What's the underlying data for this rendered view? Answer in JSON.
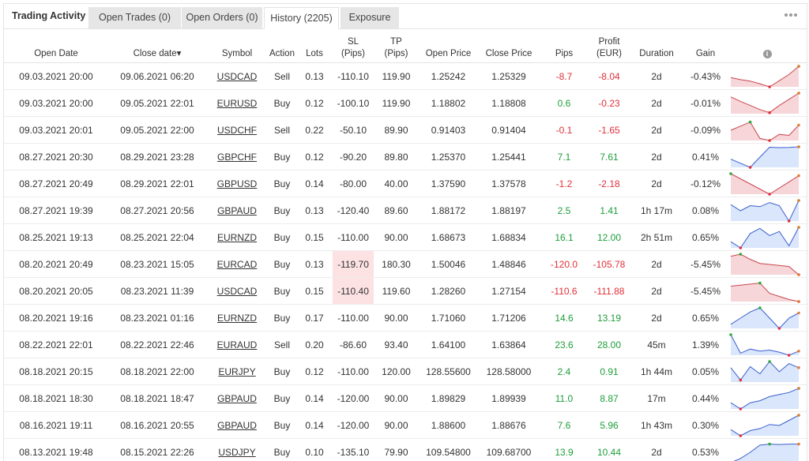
{
  "title": "Trading Activity",
  "tabs": [
    {
      "label": "Open Trades (0)"
    },
    {
      "label": "Open Orders (0)"
    },
    {
      "label": "History (2205)"
    },
    {
      "label": "Exposure"
    }
  ],
  "active_tab": "History (2205)",
  "columns": {
    "open_date": "Open Date",
    "close_date": "Close date",
    "sort_arrow": "▾",
    "symbol": "Symbol",
    "action": "Action",
    "lots": "Lots",
    "sl_1": "SL",
    "sl_2": "(Pips)",
    "tp_1": "TP",
    "tp_2": "(Pips)",
    "open_price": "Open Price",
    "close_price": "Close Price",
    "pips": "Pips",
    "profit_1": "Profit",
    "profit_2": "(EUR)",
    "duration": "Duration",
    "gain": "Gain",
    "info_glyph": "i"
  },
  "colors": {
    "positive": "#1e9e3a",
    "negative": "#e0303a",
    "spark_profit_fill": "#d9e6fb",
    "spark_profit_line": "#3a5fcd",
    "spark_loss_fill": "#f6d6d8",
    "spark_loss_line": "#c8474f"
  },
  "rows": [
    {
      "open_date": "09.03.2021 20:00",
      "close_date": "09.06.2021 06:20",
      "symbol": "USDCAD",
      "action": "Sell",
      "lots": "0.13",
      "sl": "-110.10",
      "tp": "119.90",
      "open_price": "1.25242",
      "close_price": "1.25329",
      "pips": "-8.7",
      "profit": "-8.04",
      "duration": "2d",
      "gain": "-0.43%",
      "spark": [
        0.45,
        0.35,
        0.28,
        0.15,
        0.0,
        0.3,
        0.6,
        1.0
      ]
    },
    {
      "open_date": "09.03.2021 20:00",
      "close_date": "09.05.2021 22:01",
      "symbol": "EURUSD",
      "action": "Buy",
      "lots": "0.12",
      "sl": "-100.10",
      "tp": "119.90",
      "open_price": "1.18802",
      "close_price": "1.18808",
      "pips": "0.6",
      "profit": "-0.23",
      "duration": "2d",
      "gain": "-0.01%",
      "spark": [
        0.82,
        0.6,
        0.4,
        0.2,
        0.05,
        0.4,
        0.7,
        1.0
      ]
    },
    {
      "open_date": "09.03.2021 20:01",
      "close_date": "09.05.2021 22:00",
      "symbol": "USDCHF",
      "action": "Sell",
      "lots": "0.22",
      "sl": "-50.10",
      "tp": "89.90",
      "open_price": "0.91403",
      "close_price": "0.91404",
      "pips": "-0.1",
      "profit": "-1.65",
      "duration": "2d",
      "gain": "-0.09%",
      "spark": [
        0.5,
        0.7,
        0.9,
        0.1,
        0.0,
        0.3,
        0.25,
        0.75
      ]
    },
    {
      "open_date": "08.27.2021 20:30",
      "close_date": "08.29.2021 23:28",
      "symbol": "GBPCHF",
      "action": "Buy",
      "lots": "0.12",
      "sl": "-90.20",
      "tp": "89.80",
      "open_price": "1.25370",
      "close_price": "1.25441",
      "pips": "7.1",
      "profit": "7.61",
      "duration": "2d",
      "gain": "0.41%",
      "spark": [
        0.4,
        0.2,
        0.0,
        0.5,
        0.98,
        0.96,
        0.97,
        1.0
      ]
    },
    {
      "open_date": "08.27.2021 20:49",
      "close_date": "08.29.2021 22:01",
      "symbol": "GBPUSD",
      "action": "Buy",
      "lots": "0.14",
      "sl": "-80.00",
      "tp": "40.00",
      "open_price": "1.37590",
      "close_price": "1.37578",
      "pips": "-1.2",
      "profit": "-2.18",
      "duration": "2d",
      "gain": "-0.12%",
      "spark": [
        1.0,
        0.75,
        0.5,
        0.25,
        0.0,
        0.3,
        0.6,
        0.9
      ]
    },
    {
      "open_date": "08.27.2021 19:39",
      "close_date": "08.27.2021 20:56",
      "symbol": "GBPAUD",
      "action": "Buy",
      "lots": "0.13",
      "sl": "-120.40",
      "tp": "89.60",
      "open_price": "1.88172",
      "close_price": "1.88197",
      "pips": "2.5",
      "profit": "1.41",
      "duration": "1h 17m",
      "gain": "0.08%",
      "spark": [
        0.8,
        0.5,
        0.75,
        0.7,
        0.9,
        0.75,
        0.0,
        1.0
      ]
    },
    {
      "open_date": "08.25.2021 19:13",
      "close_date": "08.25.2021 22:04",
      "symbol": "EURNZD",
      "action": "Buy",
      "lots": "0.15",
      "sl": "-110.00",
      "tp": "90.00",
      "open_price": "1.68673",
      "close_price": "1.68834",
      "pips": "16.1",
      "profit": "12.00",
      "duration": "2h 51m",
      "gain": "0.65%",
      "spark": [
        0.3,
        0.0,
        0.7,
        0.95,
        0.6,
        0.8,
        0.1,
        1.0
      ]
    },
    {
      "open_date": "08.20.2021 20:49",
      "close_date": "08.23.2021 15:05",
      "symbol": "EURCAD",
      "action": "Buy",
      "lots": "0.13",
      "sl": "-119.70",
      "tp": "180.30",
      "open_price": "1.50046",
      "close_price": "1.48846",
      "pips": "-120.0",
      "profit": "-105.78",
      "duration": "2d",
      "gain": "-5.45%",
      "spark": [
        0.9,
        1.0,
        0.75,
        0.55,
        0.5,
        0.45,
        0.4,
        0.0
      ]
    },
    {
      "open_date": "08.20.2021 20:05",
      "close_date": "08.23.2021 11:39",
      "symbol": "USDCAD",
      "action": "Buy",
      "lots": "0.15",
      "sl": "-110.40",
      "tp": "119.60",
      "open_price": "1.28260",
      "close_price": "1.27154",
      "pips": "-110.6",
      "profit": "-111.88",
      "duration": "2d",
      "gain": "-5.45%",
      "spark": [
        0.75,
        0.8,
        0.85,
        0.9,
        0.4,
        0.25,
        0.1,
        0.0
      ]
    },
    {
      "open_date": "08.20.2021 19:16",
      "close_date": "08.23.2021 01:16",
      "symbol": "EURNZD",
      "action": "Buy",
      "lots": "0.17",
      "sl": "-110.00",
      "tp": "90.00",
      "open_price": "1.71060",
      "close_price": "1.71206",
      "pips": "14.6",
      "profit": "13.19",
      "duration": "2d",
      "gain": "0.65%",
      "spark": [
        0.2,
        0.5,
        0.8,
        1.0,
        0.5,
        0.0,
        0.5,
        0.75
      ]
    },
    {
      "open_date": "08.22.2021 22:01",
      "close_date": "08.22.2021 22:46",
      "symbol": "EURAUD",
      "action": "Sell",
      "lots": "0.20",
      "sl": "-86.60",
      "tp": "93.40",
      "open_price": "1.64100",
      "close_price": "1.63864",
      "pips": "23.6",
      "profit": "28.00",
      "duration": "45m",
      "gain": "1.39%",
      "spark": [
        1.0,
        0.1,
        0.3,
        0.2,
        0.25,
        0.15,
        0.0,
        0.2
      ]
    },
    {
      "open_date": "08.18.2021 20:15",
      "close_date": "08.18.2021 22:00",
      "symbol": "EURJPY",
      "action": "Buy",
      "lots": "0.12",
      "sl": "-110.00",
      "tp": "120.00",
      "open_price": "128.55600",
      "close_price": "128.58000",
      "pips": "2.4",
      "profit": "0.91",
      "duration": "1h 44m",
      "gain": "0.05%",
      "spark": [
        0.7,
        0.1,
        0.75,
        0.4,
        1.0,
        0.5,
        0.9,
        0.7
      ]
    },
    {
      "open_date": "08.18.2021 18:30",
      "close_date": "08.18.2021 18:47",
      "symbol": "GBPAUD",
      "action": "Buy",
      "lots": "0.14",
      "sl": "-120.00",
      "tp": "90.00",
      "open_price": "1.89829",
      "close_price": "1.89939",
      "pips": "11.0",
      "profit": "8.87",
      "duration": "17m",
      "gain": "0.44%",
      "spark": [
        0.3,
        0.0,
        0.3,
        0.4,
        0.6,
        0.7,
        0.8,
        1.0
      ]
    },
    {
      "open_date": "08.16.2021 19:11",
      "close_date": "08.16.2021 20:55",
      "symbol": "GBPAUD",
      "action": "Buy",
      "lots": "0.14",
      "sl": "-120.00",
      "tp": "90.00",
      "open_price": "1.88600",
      "close_price": "1.88676",
      "pips": "7.6",
      "profit": "5.96",
      "duration": "1h 43m",
      "gain": "0.30%",
      "spark": [
        0.3,
        0.0,
        0.25,
        0.35,
        0.55,
        0.5,
        0.75,
        1.0
      ]
    },
    {
      "open_date": "08.13.2021 19:48",
      "close_date": "08.15.2021 22:26",
      "symbol": "USDJPY",
      "action": "Buy",
      "lots": "0.10",
      "sl": "-135.10",
      "tp": "79.90",
      "open_price": "109.54800",
      "close_price": "109.68700",
      "pips": "13.9",
      "profit": "10.44",
      "duration": "2d",
      "gain": "0.53%",
      "spark": [
        0.0,
        0.2,
        0.5,
        0.85,
        0.9,
        0.88,
        0.9,
        0.9
      ]
    }
  ]
}
